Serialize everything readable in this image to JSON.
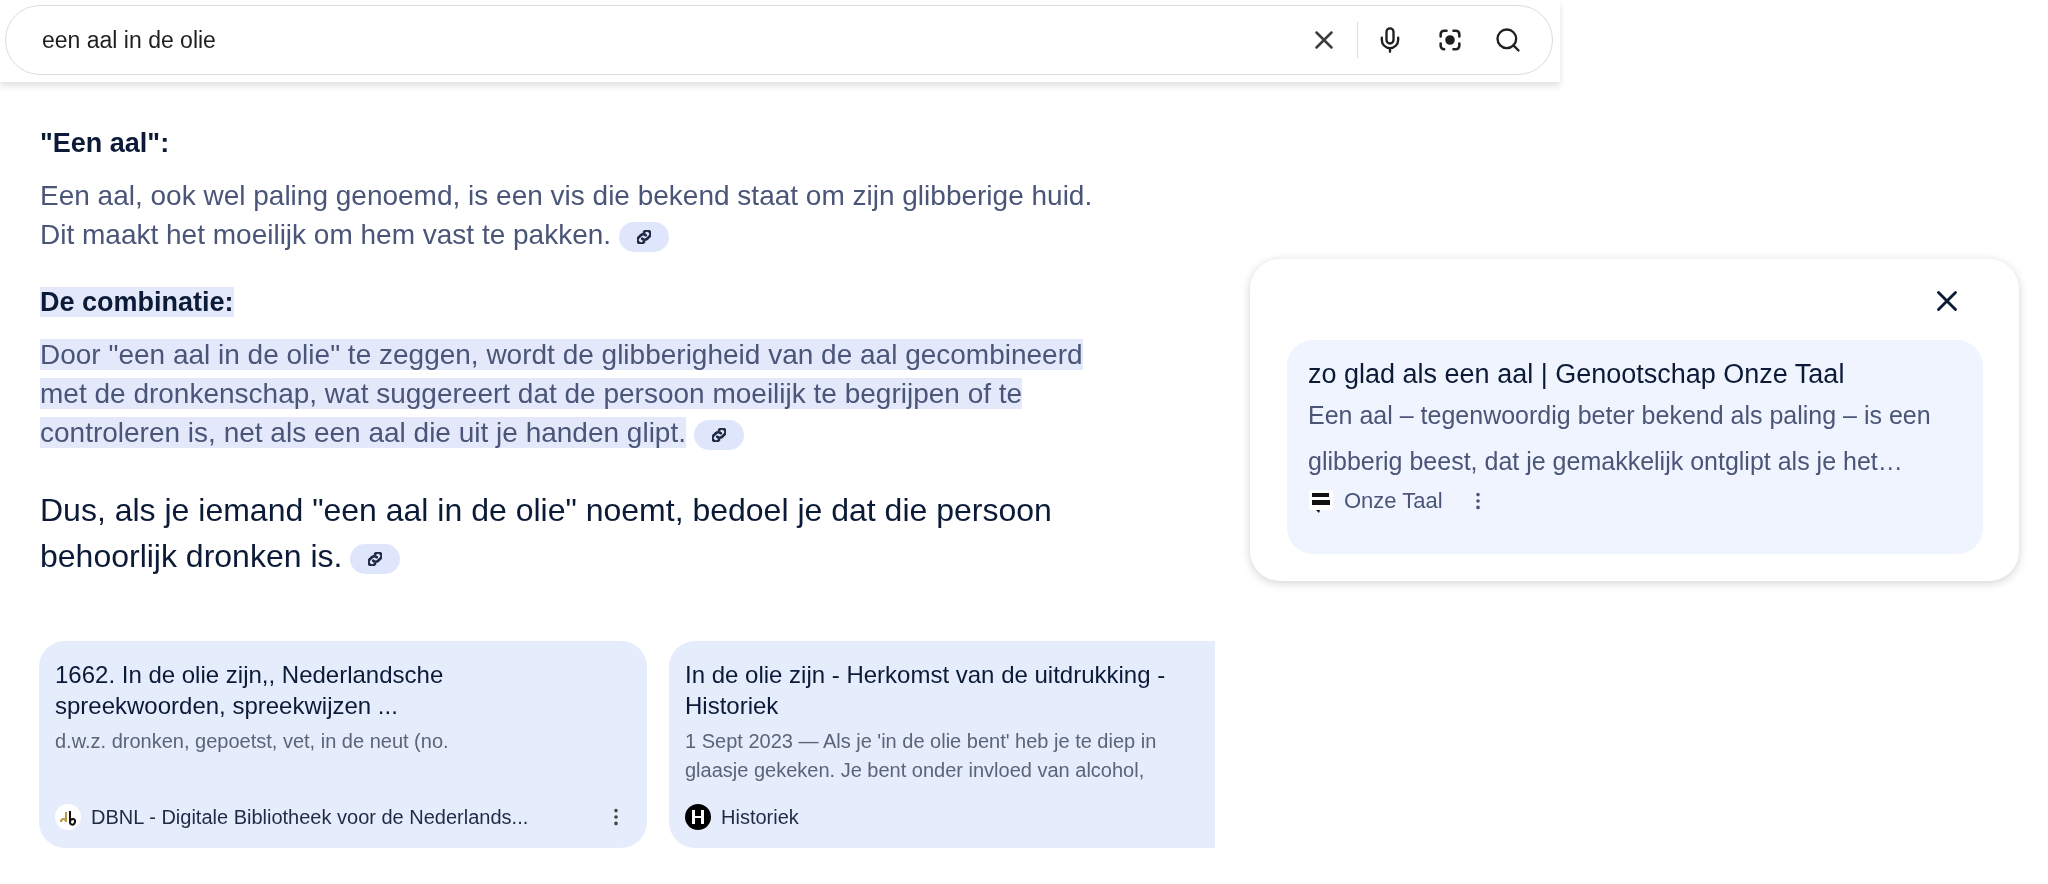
{
  "search": {
    "value": "een aal in de olie"
  },
  "answer": {
    "blocks": [
      {
        "kind": "heading",
        "text": "\"Een aal\":",
        "highlighted": false,
        "link": false
      },
      {
        "kind": "paragraph",
        "text": "Een aal, ook wel paling genoemd, is een vis die bekend staat om zijn glibberige huid. Dit maakt het moeilijk om hem vast te pakken.",
        "highlighted": false,
        "link": true
      },
      {
        "kind": "heading",
        "text": "De combinatie:",
        "highlighted": true,
        "link": false
      },
      {
        "kind": "paragraph",
        "text": "Door \"een aal in de olie\" te zeggen, wordt de glibberigheid van de aal gecombineerd met de dronkenschap, wat suggereert dat de persoon moeilijk te begrijpen of te controleren is, net als een aal die uit je handen glipt.",
        "highlighted": true,
        "link": true
      },
      {
        "kind": "summary",
        "text": "Dus, als je iemand \"een aal in de olie\" noemt, bedoel je dat die persoon behoorlijk dronken is.",
        "highlighted": false,
        "link": true
      }
    ]
  },
  "source_cards": [
    {
      "title": "1662. In de olie zijn,, Nederlandsche spreekwoorden, spreekwijzen ...",
      "snippet_lines": [
        "d.w.z. dronken, gepoetst, vet, in de neut (no."
      ],
      "source": "DBNL - Digitale Bibliotheek voor de Nederlands...",
      "kind": "dbnl",
      "menu": true
    },
    {
      "title": "In de olie zijn - Herkomst van de uitdrukking - Historiek",
      "snippet_lines": [
        "1 Sept 2023 — Als je 'in de olie bent' heb je te diep in",
        "glaasje gekeken. Je bent onder invloed van alcohol,"
      ],
      "source": "Historiek",
      "kind": "historiek",
      "menu": false
    }
  ],
  "popup": {
    "card": {
      "title": "zo glad als een aal | Genootschap Onze Taal",
      "snippet": "Een aal – tegenwoordig beter bekend als paling – is een glibberig beest, dat je gemakkelijk ontglipt als je het…",
      "source": "Onze Taal",
      "kind": "onzetaal",
      "menu": true
    }
  }
}
